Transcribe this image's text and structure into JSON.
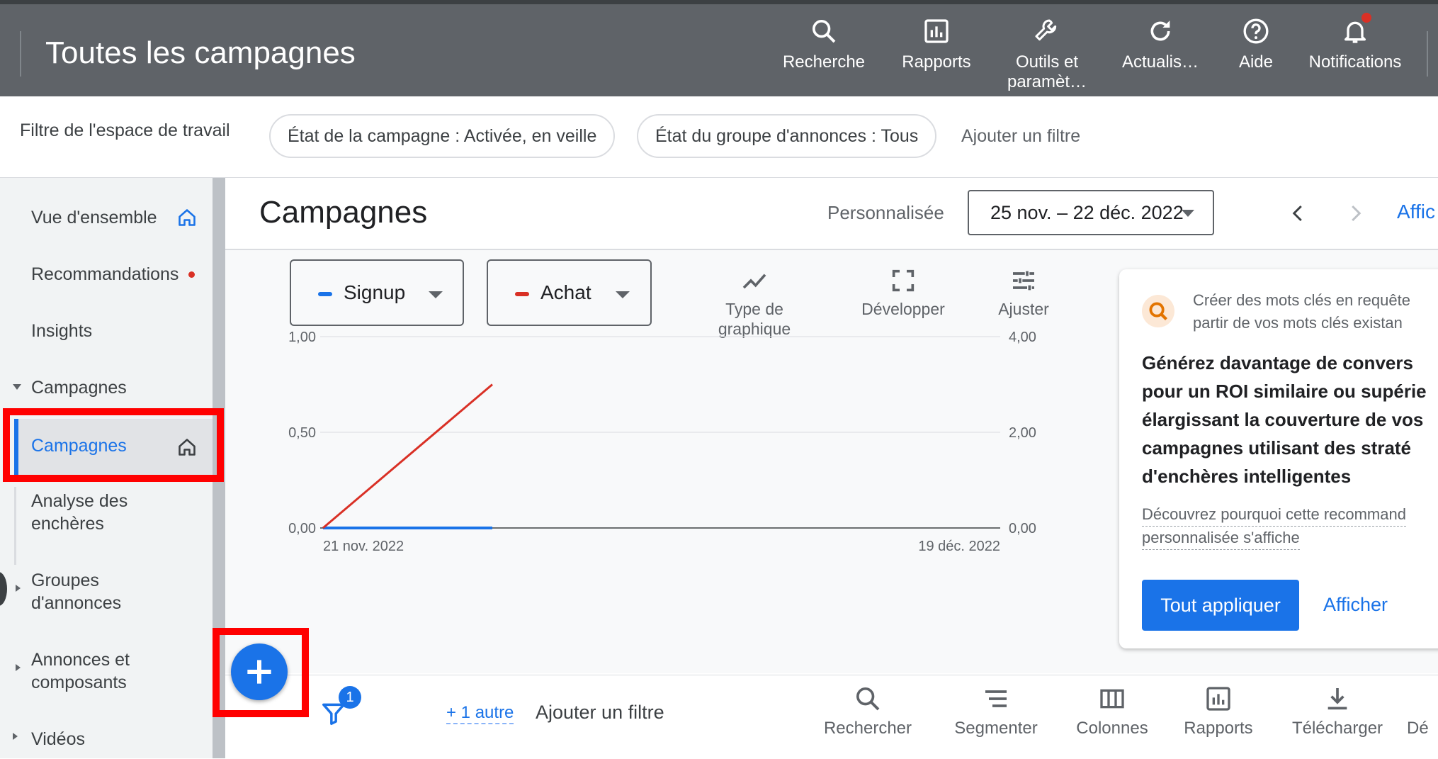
{
  "topbar": {
    "title": "Toutes les campagnes",
    "items": [
      {
        "label": "Recherche",
        "icon": "search-icon"
      },
      {
        "label": "Rapports",
        "icon": "reports-icon"
      },
      {
        "label": "Outils et paramèt…",
        "icon": "tools-icon"
      },
      {
        "label": "Actualis…",
        "icon": "refresh-icon"
      },
      {
        "label": "Aide",
        "icon": "help-icon"
      },
      {
        "label": "Notifications",
        "icon": "bell-icon"
      }
    ]
  },
  "filterbar": {
    "label": "Filtre de l'espace de travail",
    "chips": [
      "État de la campagne : Activée, en veille",
      "État du groupe d'annonces : Tous"
    ],
    "add_filter": "Ajouter un filtre"
  },
  "sidebar": {
    "items": [
      {
        "label": "Vue d'ensemble"
      },
      {
        "label": "Recommandations"
      },
      {
        "label": "Insights"
      },
      {
        "label": "Campagnes"
      },
      {
        "label": "Campagnes"
      },
      {
        "label": "Analyse des enchères"
      },
      {
        "label": "Groupes d'annonces"
      },
      {
        "label": "Annonces et composants"
      },
      {
        "label": "Vidéos"
      }
    ]
  },
  "main": {
    "title": "Campagnes",
    "date_type": "Personnalisée",
    "date_range": "25 nov. – 22 déc. 2022",
    "right_link": "Affic"
  },
  "chart_controls": {
    "metric1": "Signup",
    "metric2": "Achat",
    "tools": [
      "Type de graphique",
      "Développer",
      "Ajuster"
    ]
  },
  "chart_data": {
    "type": "line",
    "x": [
      "21 nov. 2022",
      "19 déc. 2022"
    ],
    "x_tick_labels": [
      "21 nov. 2022",
      "19 déc. 2022"
    ],
    "y_left_ticks": [
      "1,00",
      "0,50",
      "0,00"
    ],
    "y_right_ticks": [
      "4,00",
      "2,00",
      "0,00"
    ],
    "ylim_left": [
      0,
      1
    ],
    "ylim_right": [
      0,
      4
    ],
    "series": [
      {
        "name": "Signup",
        "color": "#1a73e8",
        "axis": "left",
        "values": [
          0,
          0
        ]
      },
      {
        "name": "Achat",
        "color": "#d93025",
        "axis": "right",
        "values": [
          0,
          3
        ]
      }
    ],
    "series_x_positions": [
      0,
      0.25
    ]
  },
  "recommendation": {
    "header": "Créer des mots clés en requête … partir de vos mots clés existan…",
    "header_line1": "Créer des mots clés en requête",
    "header_line2": "partir de vos mots clés existan",
    "body": [
      "Générez davantage de convers",
      "pour un ROI similaire ou supérie",
      "élargissant la couverture de vos",
      "campagnes utilisant des straté",
      "d'enchères intelligentes"
    ],
    "link_line1": "Découvrez pourquoi cette recommand",
    "link_line2": "personnalisée s'affiche",
    "apply_all": "Tout appliquer",
    "show": "Afficher"
  },
  "bottom": {
    "filter_badge": "1",
    "more": "+ 1 autre",
    "add_filter": "Ajouter un filtre",
    "tools": [
      "Rechercher",
      "Segmenter",
      "Colonnes",
      "Rapports",
      "Télécharger",
      "Dé"
    ]
  },
  "colors": {
    "topbar": "#5f6368",
    "accent": "#1a73e8",
    "red": "#d93025",
    "highlight_box": "#ff0000"
  }
}
